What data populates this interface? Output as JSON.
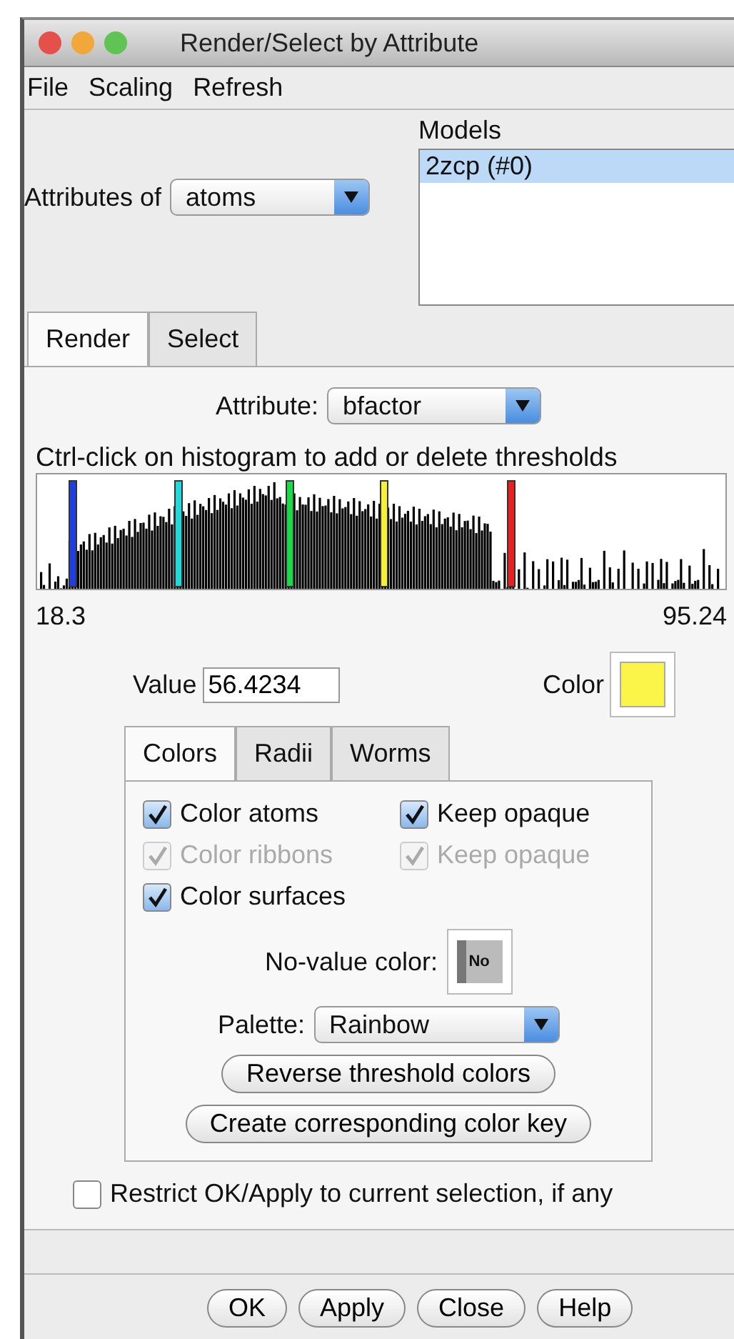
{
  "window": {
    "title": "Render/Select by Attribute"
  },
  "menu": [
    "File",
    "Scaling",
    "Refresh"
  ],
  "attributes_of": {
    "label": "Attributes of",
    "value": "atoms"
  },
  "models": {
    "label": "Models",
    "items": [
      {
        "label": "2zcp (#0)",
        "selected": true
      }
    ]
  },
  "tabs": [
    {
      "label": "Render",
      "selected": true
    },
    {
      "label": "Select",
      "selected": false
    }
  ],
  "attribute": {
    "label": "Attribute:",
    "value": "bfactor"
  },
  "hint": "Ctrl-click on histogram to add or delete thresholds",
  "thresholds": [
    {
      "color": "#1f3fe0",
      "level": 0.046
    },
    {
      "color": "#22d8d8",
      "level": 0.2
    },
    {
      "color": "#1fd84a",
      "level": 0.36
    },
    {
      "color": "#f5f03a",
      "level": 0.497
    },
    {
      "color": "#e82020",
      "level": 0.682
    }
  ],
  "range": {
    "min": "18.3",
    "max": "95.24"
  },
  "value": {
    "label": "Value",
    "value": "56.4234"
  },
  "color": {
    "label": "Color",
    "color": "#fbf54a"
  },
  "subtabs": [
    {
      "label": "Colors",
      "selected": true
    },
    {
      "label": "Radii",
      "selected": false
    },
    {
      "label": "Worms",
      "selected": false
    }
  ],
  "checkbox_rows": [
    [
      {
        "label": "Color atoms",
        "checked": true,
        "disabled": false
      },
      {
        "label": "Keep opaque",
        "checked": true,
        "disabled": false
      }
    ],
    [
      {
        "label": "Color ribbons",
        "checked": true,
        "disabled": true
      },
      {
        "label": "Keep opaque",
        "checked": true,
        "disabled": true
      }
    ],
    [
      {
        "label": "Color surfaces",
        "checked": true,
        "disabled": false
      }
    ]
  ],
  "no_value": {
    "label": "No-value color:",
    "swatch": "No"
  },
  "palette": {
    "label": "Palette:",
    "value": "Rainbow"
  },
  "panel_buttons": [
    "Reverse threshold colors",
    "Create corresponding color key"
  ],
  "restrict": {
    "label": "Restrict OK/Apply to current selection, if any",
    "checked": false
  },
  "buttons": [
    "OK",
    "Apply",
    "Close",
    "Help"
  ]
}
